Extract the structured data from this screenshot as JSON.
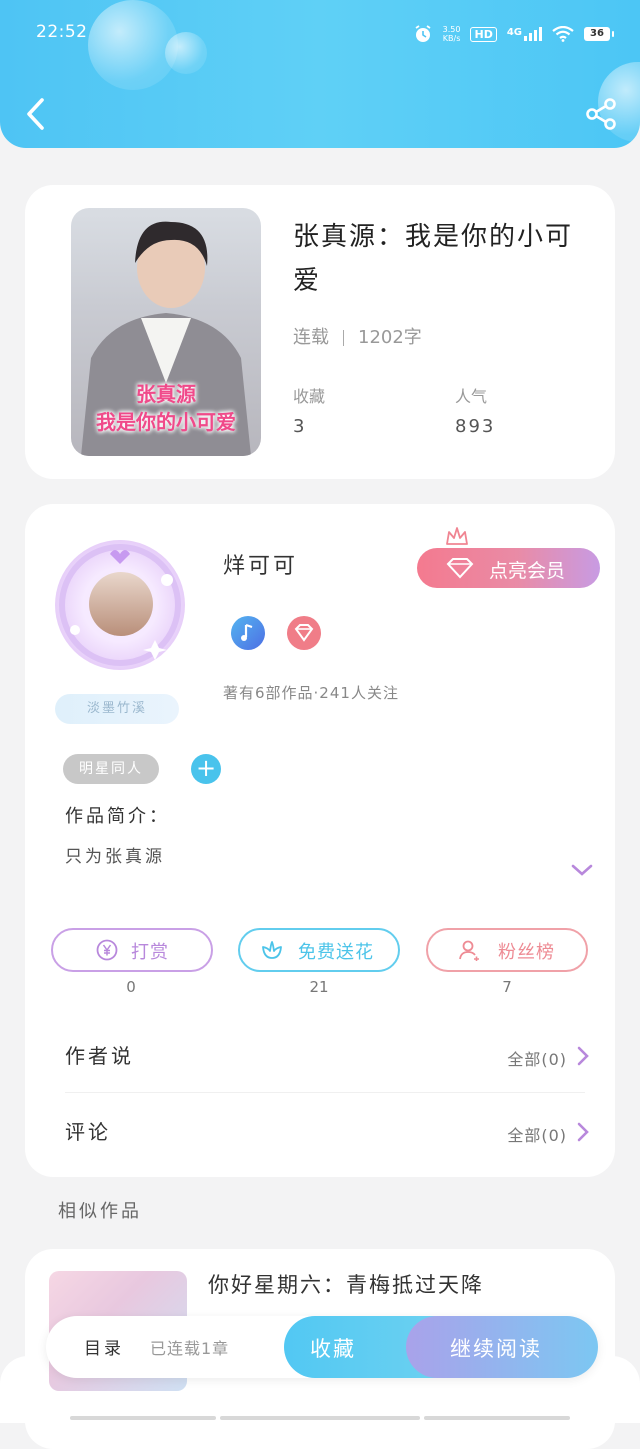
{
  "status_bar": {
    "time": "22:52",
    "speed_value": "3.50",
    "speed_unit": "KB/s",
    "hd": "HD",
    "network": "4G",
    "battery": "36"
  },
  "header": {
    "back_icon": "chevron-left-icon",
    "share_icon": "share-icon"
  },
  "book": {
    "cover_line1": "张真源",
    "cover_line2": "我是你的小可爱",
    "title": "张真源：我是你的小可爱",
    "status": "连载",
    "word_count": "1202字",
    "favorites_label": "收藏",
    "favorites_value": "3",
    "popularity_label": "人气",
    "popularity_value": "893"
  },
  "author": {
    "name": "烊可可",
    "avatar_badge": "淡墨竹溪",
    "vip_label": "点亮会员",
    "works_info": "著有6部作品·241人关注",
    "tag": "明星同人",
    "intro_title": "作品简介：",
    "intro_text": "只为张真源"
  },
  "actions": [
    {
      "label": "打赏",
      "count": "0",
      "color": "#b888dc"
    },
    {
      "label": "免费送花",
      "count": "21",
      "color": "#4cc4e9"
    },
    {
      "label": "粉丝榜",
      "count": "7",
      "color": "#ee8b94"
    }
  ],
  "author_says": {
    "label": "作者说",
    "link": "全部(0)"
  },
  "comments": {
    "label": "评论",
    "link": "全部(0)"
  },
  "similar": {
    "title": "相似作品",
    "items": [
      {
        "title": "你好星期六：青梅抵过天降"
      }
    ]
  },
  "bottom_bar": {
    "toc": "目录",
    "status": "已连载1章",
    "favorite": "收藏",
    "continue": "继续阅读"
  },
  "colors": {
    "header": "#4ec4f4",
    "accent_purple": "#b888dc",
    "accent_blue": "#4cc4e9",
    "accent_red": "#ee8b94"
  }
}
